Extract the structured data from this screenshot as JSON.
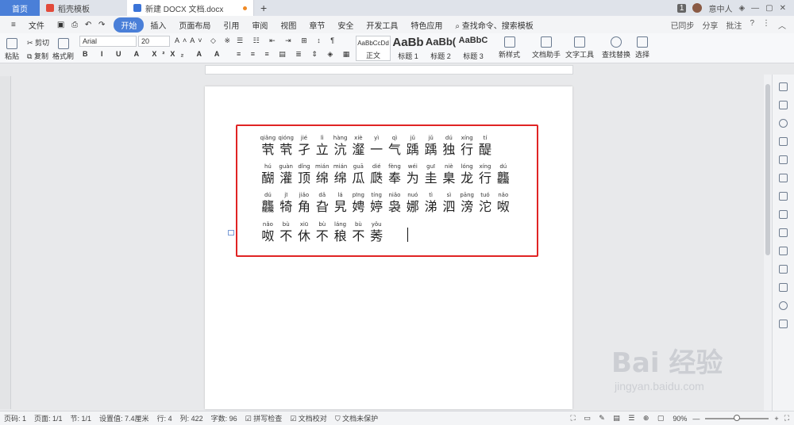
{
  "titlebar": {
    "home": "首页",
    "tab1": "稻壳模板",
    "tab2": "新建 DOCX 文档.docx",
    "plus": "+",
    "user": "意中人",
    "counter": "1"
  },
  "menubar": {
    "file": "文件",
    "items": [
      "开始",
      "插入",
      "页面布局",
      "引用",
      "审阅",
      "视图",
      "章节",
      "安全",
      "开发工具",
      "特色应用"
    ],
    "search": "查找命令、搜索模板",
    "sync": "已同步",
    "share": "分享",
    "comment": "批注"
  },
  "ribbon": {
    "cut": "剪切",
    "copy": "复制",
    "paste": "粘贴",
    "format_painter": "格式刷",
    "font": "Arial",
    "size": "20",
    "styles": [
      {
        "preview": "AaBbCcDd",
        "label": "正文"
      },
      {
        "preview": "AaBb",
        "label": "标题 1"
      },
      {
        "preview": "AaBb(",
        "label": "标题 2"
      },
      {
        "preview": "AaBbC",
        "label": "标题 3"
      }
    ],
    "new_style": "新样式",
    "doc_helper": "文档助手",
    "text_tools": "文字工具",
    "find_replace": "查找替换",
    "select": "选择"
  },
  "doc": {
    "lines": [
      [
        [
          "qiǎng",
          "茕"
        ],
        [
          "qióng",
          "茕"
        ],
        [
          "jié",
          "孑"
        ],
        [
          "lì",
          "立"
        ],
        [
          "hàng",
          "沆"
        ],
        [
          "xiè",
          "瀣"
        ],
        [
          "yì",
          "一"
        ],
        [
          "qì",
          "气"
        ],
        [
          "jǔ",
          "踽"
        ],
        [
          "jǔ",
          "踽"
        ],
        [
          "dú",
          "独"
        ],
        [
          "xíng",
          "行"
        ],
        [
          "tí",
          "醍"
        ]
      ],
      [
        [
          "hú",
          "醐"
        ],
        [
          "guàn",
          "灌"
        ],
        [
          "dǐng",
          "顶"
        ],
        [
          "mián",
          "绵"
        ],
        [
          "mián",
          "绵"
        ],
        [
          "guā",
          "瓜"
        ],
        [
          "dié",
          "瓞"
        ],
        [
          "fèng",
          "奉"
        ],
        [
          "wéi",
          "为"
        ],
        [
          "guī",
          "圭"
        ],
        [
          "niè",
          "臬"
        ],
        [
          "lóng",
          "龙"
        ],
        [
          "xíng",
          "行"
        ],
        [
          "dú",
          "龘"
        ]
      ],
      [
        [
          "dú",
          "龘"
        ],
        [
          "jī",
          "犄"
        ],
        [
          "jiǎo",
          "角"
        ],
        [
          "dǎ",
          "旮"
        ],
        [
          "lá",
          "旯"
        ],
        [
          "pīng",
          "娉"
        ],
        [
          "tíng",
          "婷"
        ],
        [
          "niǎo",
          "袅"
        ],
        [
          "nuó",
          "娜"
        ],
        [
          "tì",
          "涕"
        ],
        [
          "sì",
          "泗"
        ],
        [
          "pāng",
          "滂"
        ],
        [
          "tuó",
          "沱"
        ],
        [
          "nǎo",
          "呶"
        ]
      ],
      [
        [
          "nǎo",
          "呶"
        ],
        [
          "bù",
          "不"
        ],
        [
          "xiū",
          "休"
        ],
        [
          "bù",
          "不"
        ],
        [
          "láng",
          "稂"
        ],
        [
          "bù",
          "不"
        ],
        [
          "yǒu",
          "莠"
        ]
      ]
    ]
  },
  "status": {
    "page": "页码: 1",
    "pages": "页面: 1/1",
    "section": "节: 1/1",
    "setting": "设置值: 7.4厘米",
    "row": "行: 4",
    "col": "列: 422",
    "words": "字数: 96",
    "spell": "拼写检查",
    "proof": "文档校对",
    "protect": "文档未保护",
    "zoom": "90%"
  },
  "watermark": {
    "brand": "Bai 经验",
    "url": "jingyan.baidu.com"
  }
}
